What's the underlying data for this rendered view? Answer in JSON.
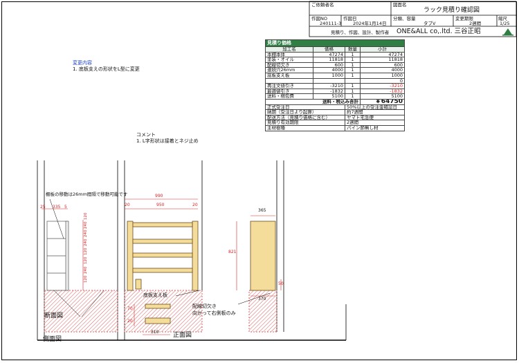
{
  "title_block": {
    "customer_label": "ご依頼者名",
    "drawing_name_label": "図面名",
    "drawing_name": "ラック見積り確認図",
    "drawing_no_label": "作図NO",
    "drawing_no": "240111-3",
    "date_label": "作図日",
    "date": "2024年1月14日",
    "type_label": "分類、容量",
    "type_value": "タブV",
    "change_label": "変更期限",
    "change_value": "2週間",
    "scale_label": "縮尺",
    "scale_value": "1/25",
    "maker_label": "見積り、作図、設計、製作者",
    "maker": "ONE&ALL co,.ltd. 三谷正昭"
  },
  "notes": {
    "change_title": "変更内容",
    "change_text": "1. 底板支えの形状をL型に変更",
    "comment_title": "コメント",
    "comment_text": "1. L字形状は接着とネジ止め"
  },
  "price_table": {
    "title": "見積り価格",
    "columns": [
      "加工名",
      "価格",
      "数量",
      "小計"
    ],
    "rows": [
      {
        "name": "本棚本体",
        "price": "47274",
        "qty": "1",
        "sub": "47274",
        "red": false
      },
      {
        "name": "塗装・オイル",
        "price": "11818",
        "qty": "1",
        "sub": "11818",
        "red": false
      },
      {
        "name": "配線切欠き",
        "price": "600",
        "qty": "1",
        "sub": "600",
        "red": false
      },
      {
        "name": "連続穴26mm",
        "price": "4000",
        "qty": "1",
        "sub": "4000",
        "red": false
      },
      {
        "name": "底板支え板",
        "price": "1000",
        "qty": "1",
        "sub": "1000",
        "red": false
      },
      {
        "name": "",
        "price": "",
        "qty": "",
        "sub": "0",
        "red": false
      },
      {
        "name": "再注文値引き",
        "price": "-3210",
        "qty": "1",
        "sub": "-3210",
        "red": true
      },
      {
        "name": "最適値引き",
        "price": "-1832",
        "qty": "1",
        "sub": "-1832",
        "red": true
      },
      {
        "name": "送料・梱包費",
        "price": "5100",
        "qty": "1",
        "sub": "5100",
        "red": false
      }
    ],
    "total_label": "送料・税込み合計",
    "total_value": "￥64750",
    "info": [
      {
        "label": "正式受注日",
        "value": "50%以上の受注金確認日"
      },
      {
        "label": "納期（受注日より起算）",
        "value": "約7週間"
      },
      {
        "label": "配送方法（見積り価格に含む）",
        "value": "ヤマト宅急便"
      },
      {
        "label": "見積り有効期限",
        "value": "2週間"
      },
      {
        "label": "主材樹種",
        "value": "パイン節無し材"
      }
    ]
  },
  "drawing": {
    "shelf_note": "棚板の移動は26mm間隔で移動可能です",
    "side_dims_top": [
      "25",
      "335",
      "5"
    ],
    "side_dims_vertical": [
      "120",
      "240",
      "240",
      "240",
      "120",
      "120",
      "240",
      "120"
    ],
    "front_width_outer": "990",
    "front_dims": [
      "20",
      "950",
      "20"
    ],
    "height_dim": "821",
    "right_width": "365",
    "right_width_bottom": "370",
    "small_dim": "50",
    "bottom_support_label": "底板支え板",
    "cutout_label": "配線切欠き",
    "cutout_sub": "向かって右側板のみ",
    "detail_dims": [
      "70",
      "20",
      "310"
    ],
    "section_label": "断面図",
    "side_view_label": "側面図",
    "front_view_label": "正面図"
  },
  "colors": {
    "accent": "#2f7f45",
    "wood": "#f4dd9a",
    "hatch": "#e06060",
    "red_text": "#d22222"
  }
}
